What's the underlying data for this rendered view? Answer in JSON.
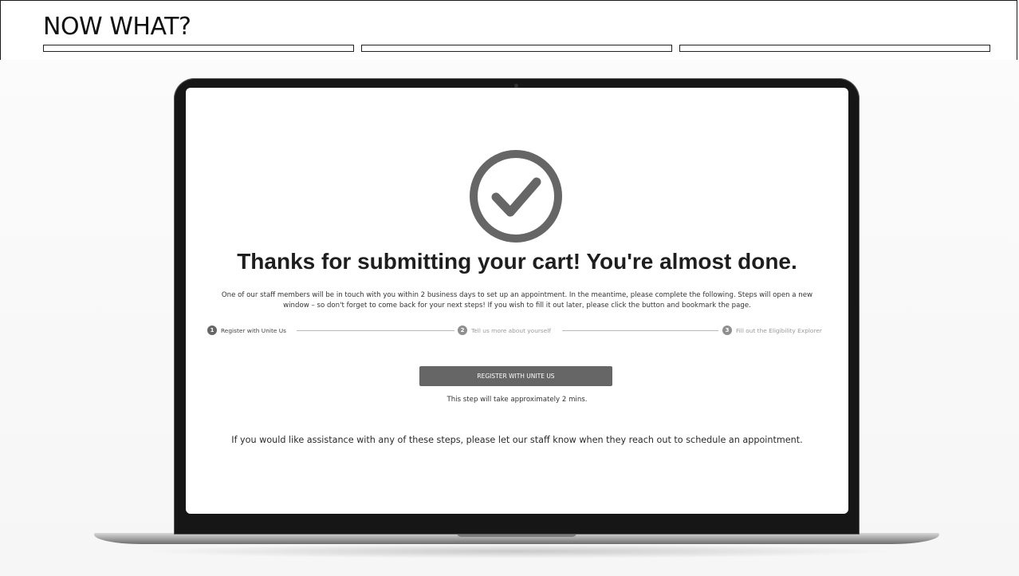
{
  "slide": {
    "title": "NOW WHAT?"
  },
  "screen": {
    "heading": "Thanks for submitting your cart! You're almost done.",
    "intro": "One of our staff members will be in touch with you within 2 business days to set up an appointment. In the meantime, please complete the following. Steps will open a new window – so don't forget to come back for your next steps! If you wish to fill it out later, please click the button and bookmark the page.",
    "steps": [
      {
        "number": "1",
        "label": "Register with Unite Us",
        "active": true
      },
      {
        "number": "2",
        "label": "Tell us more about yourself",
        "active": false
      },
      {
        "number": "3",
        "label": "Fill out the Eligibility Explorer",
        "active": false
      }
    ],
    "button_label": "REGISTER WITH UNITE US",
    "button_note": "This step will take approximately 2 mins.",
    "assistance": "If you would like assistance with any of these steps, please let our staff know when they reach out to schedule an appointment."
  },
  "icons": {
    "check": "check-circle-icon"
  },
  "colors": {
    "button": "#666666",
    "icon": "#666666",
    "heading": "#1e1e1e"
  }
}
